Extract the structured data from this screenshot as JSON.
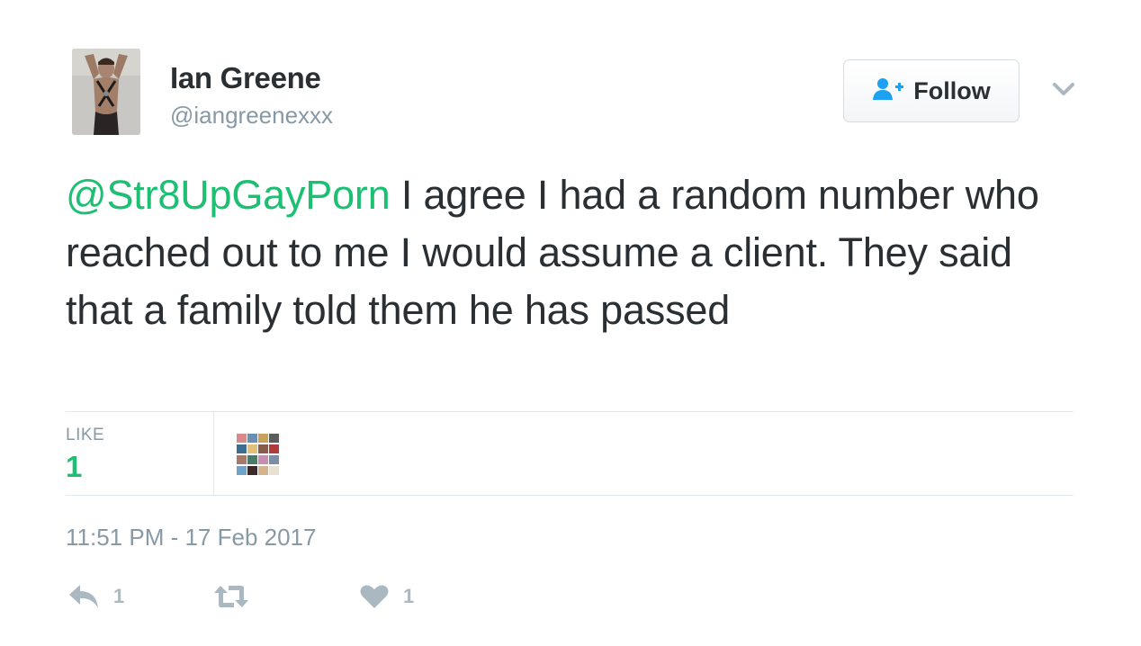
{
  "author": {
    "name": "Ian Greene",
    "handle": "@iangreenexxx"
  },
  "follow_button": {
    "label": "Follow",
    "icon": "follow-user-icon"
  },
  "menu": {
    "icon": "chevron-down-icon"
  },
  "tweet": {
    "mention": "@Str8UpGayPorn",
    "text": " I agree I had a random number who reached out to me I would assume a client. They said that a family told them he has passed"
  },
  "stats": {
    "likes_label": "LIKE",
    "likes_count": "1"
  },
  "timestamp": "11:51 PM - 17 Feb 2017",
  "actions": {
    "reply_count": "1",
    "retweet_count": "",
    "like_count": "1"
  },
  "colors": {
    "accent": "#1dbf73",
    "text": "#292f33",
    "muted": "#8899a6",
    "icon_muted": "#aab8c2",
    "rule": "#e1e8ed",
    "follow_icon": "#1da1f2"
  }
}
